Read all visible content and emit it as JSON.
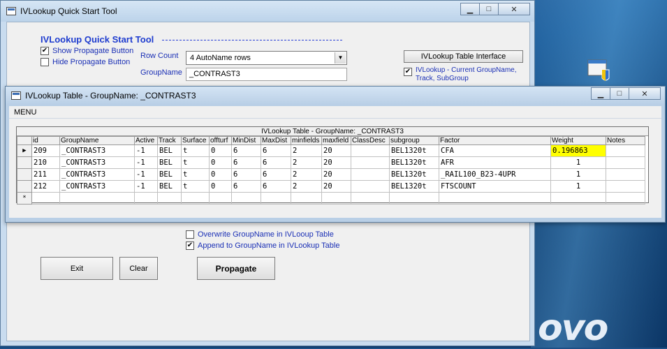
{
  "main_window": {
    "title": "IVLookup Quick Start Tool",
    "heading": "IVLookup Quick Start Tool",
    "show_propagate": {
      "label": "Show Propagate Button",
      "checked": true
    },
    "hide_propagate": {
      "label": "Hide Propagate Button",
      "checked": false
    },
    "row_count_label": "Row Count",
    "row_count_value": "4 AutoName rows",
    "groupname_label": "GroupName",
    "groupname_value": "_CONTRAST3",
    "table_interface_button": "IVLookup Table Interface",
    "current_groupname_note": "IVLookup - Current GroupName, Track, SubGroup",
    "overwrite": {
      "label": "Overwrite GroupName in IVLooup Table",
      "checked": false
    },
    "append": {
      "label": "Append to GroupName in IVLookup Table",
      "checked": true
    },
    "exit_button": "Exit",
    "clear_button": "Clear",
    "propagate_button": "Propagate",
    "minimize_glyph": "▁",
    "maximize_glyph": "□",
    "close_glyph": "✕"
  },
  "table_window": {
    "title": "IVLookup Table - GroupName: _CONTRAST3",
    "menu": "MENU",
    "caption": "IVLookup Table - GroupName: _CONTRAST3",
    "columns": [
      "id",
      "GroupName",
      "Active",
      "Track",
      "Surface",
      "offturf",
      "MinDist",
      "MaxDist",
      "minfields",
      "maxfield",
      "ClassDesc",
      "subgroup",
      "Factor",
      "Weight",
      "Notes"
    ],
    "rows": [
      {
        "marker": "▶",
        "cells": [
          "209",
          "_CONTRAST3",
          "-1",
          "BEL",
          "t",
          "0",
          "6",
          "6",
          "2",
          "20",
          "",
          "BEL1320t",
          "CFA",
          "0.196863",
          ""
        ]
      },
      {
        "marker": "",
        "cells": [
          "210",
          "_CONTRAST3",
          "-1",
          "BEL",
          "t",
          "0",
          "6",
          "6",
          "2",
          "20",
          "",
          "BEL1320t",
          "AFR",
          "1",
          ""
        ]
      },
      {
        "marker": "",
        "cells": [
          "211",
          "_CONTRAST3",
          "-1",
          "BEL",
          "t",
          "0",
          "6",
          "6",
          "2",
          "20",
          "",
          "BEL1320t",
          "_RAIL100_B23-4UPR",
          "1",
          ""
        ]
      },
      {
        "marker": "",
        "cells": [
          "212",
          "_CONTRAST3",
          "-1",
          "BEL",
          "t",
          "0",
          "6",
          "6",
          "2",
          "20",
          "",
          "BEL1320t",
          "FTSCOUNT",
          "1",
          ""
        ]
      }
    ],
    "new_row_marker": "*"
  },
  "desktop": {
    "brand_text": "ovo"
  },
  "colors": {
    "label_blue": "#1a2fb5",
    "heading_blue": "#1e3ccf",
    "highlight": "#ffff00"
  }
}
